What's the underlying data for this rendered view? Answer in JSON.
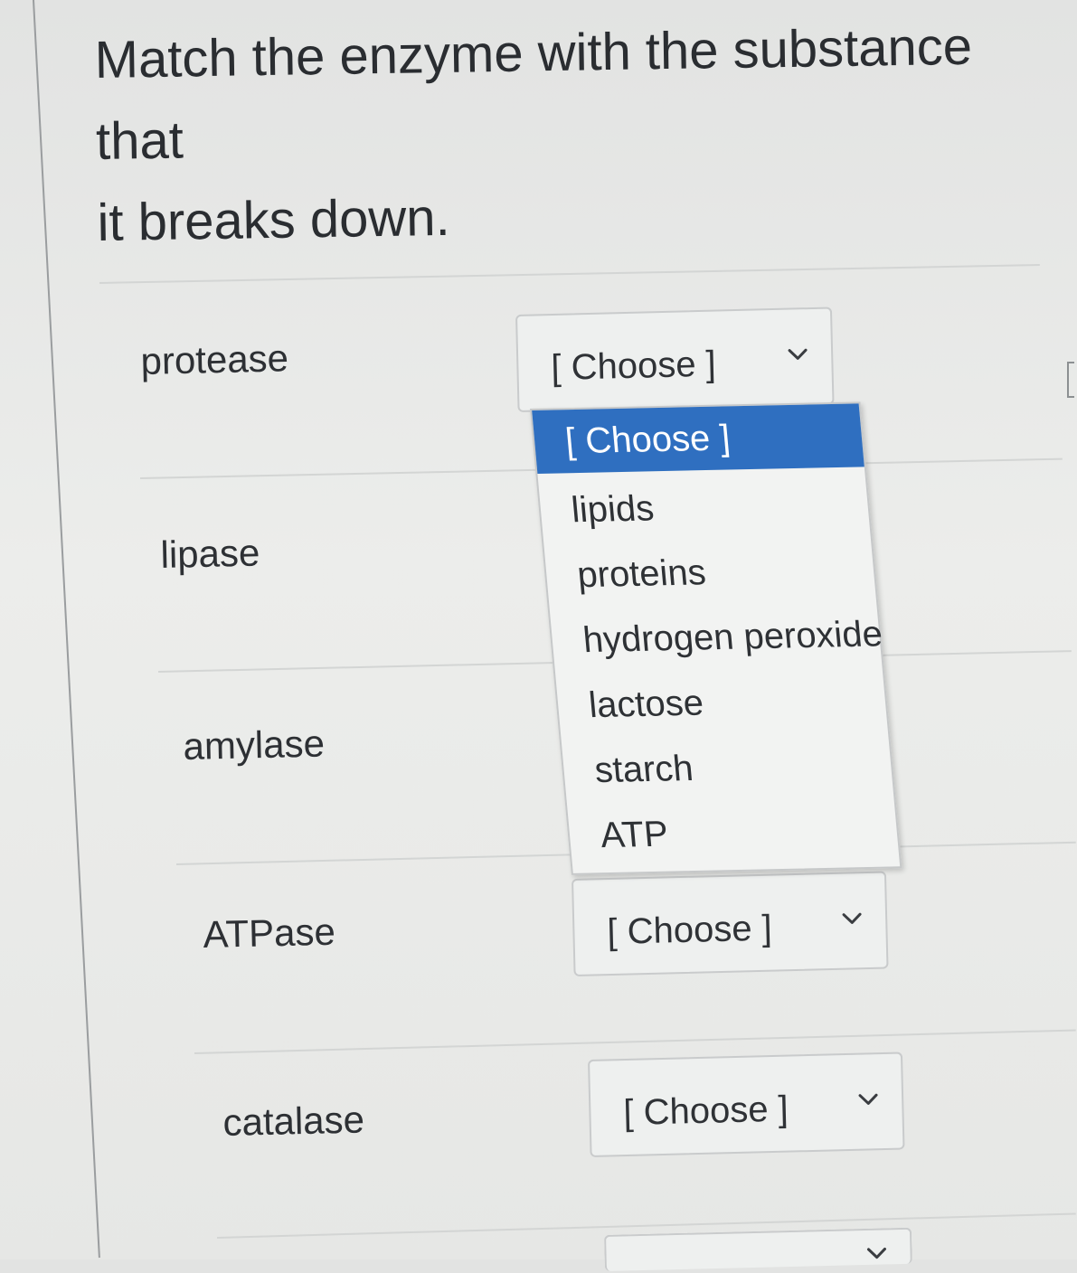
{
  "question": {
    "line1": "Match the enzyme with the substance that",
    "line2": "it breaks down."
  },
  "rows": [
    {
      "enzyme": "protease",
      "selected": "[ Choose ]"
    },
    {
      "enzyme": "lipase",
      "selected": "[ Choose ]"
    },
    {
      "enzyme": "amylase",
      "selected": "[ Choose ]"
    },
    {
      "enzyme": "ATPase",
      "selected": "[ Choose ]"
    },
    {
      "enzyme": "catalase",
      "selected": "[ Choose ]"
    }
  ],
  "dropdown": {
    "open_for": "protease",
    "options": [
      "[ Choose ]",
      "lipids",
      "proteins",
      "hydrogen peroxide",
      "lactose",
      "starch",
      "ATP"
    ],
    "highlighted_index": 0
  },
  "colors": {
    "highlight": "#2f6fc0",
    "text": "#2b2e31"
  },
  "icons": {
    "select_chevron": "chevron-down-icon"
  }
}
